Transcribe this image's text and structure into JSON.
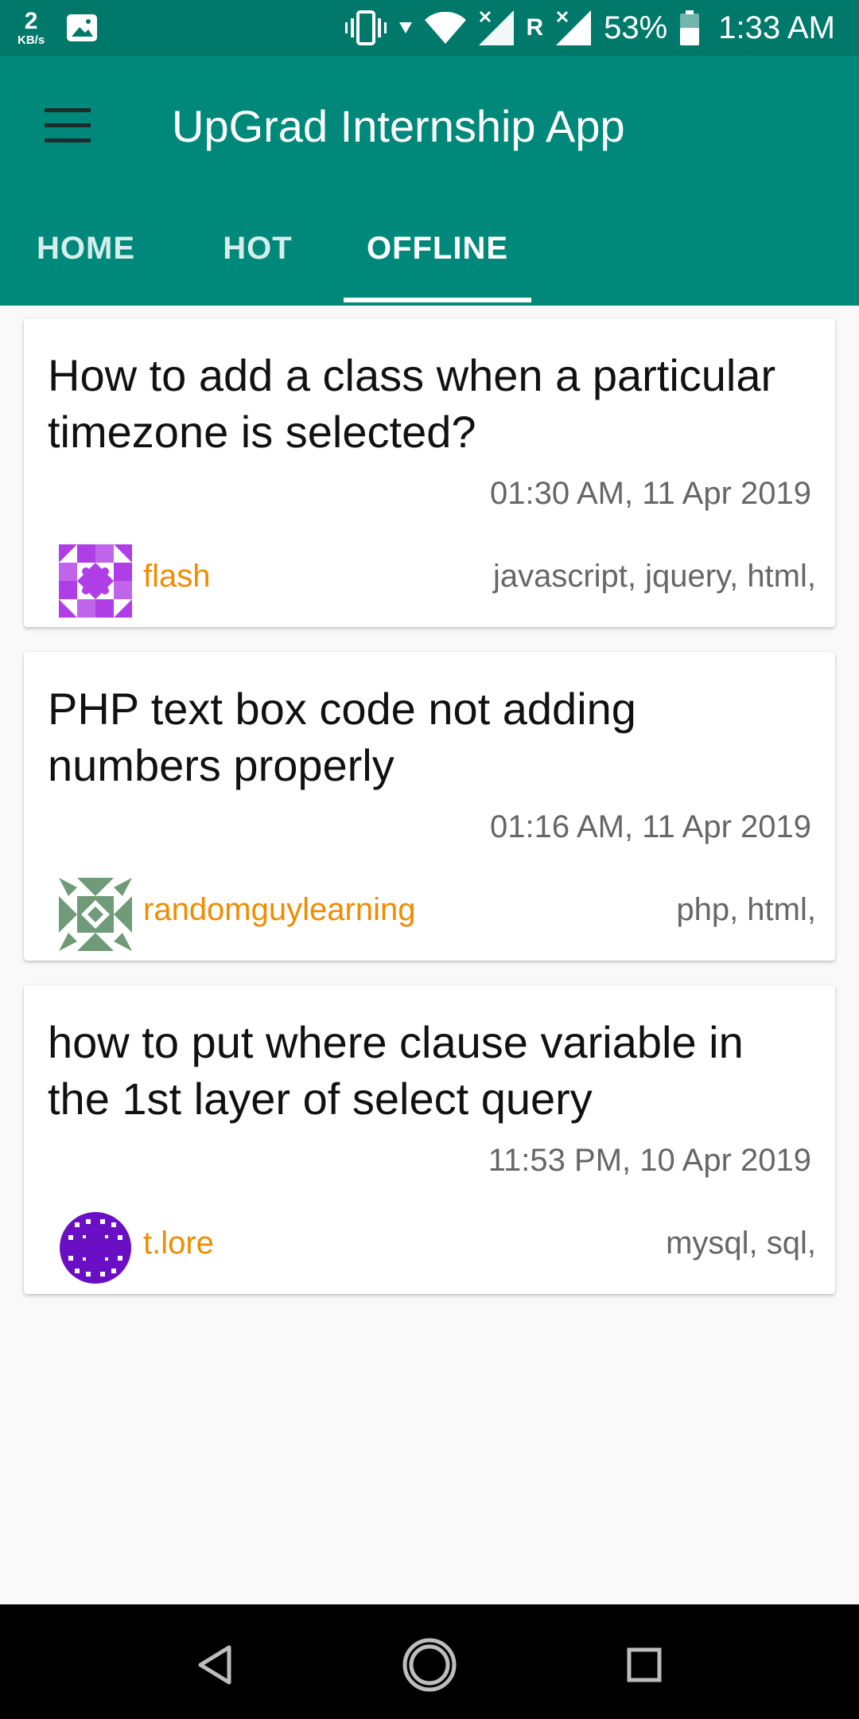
{
  "status_bar": {
    "net_speed_value": "2",
    "net_speed_unit": "KB/s",
    "roaming": "R",
    "battery_percent": "53%",
    "time": "1:33 AM"
  },
  "app_bar": {
    "title": "UpGrad Internship App",
    "tabs": [
      {
        "label": "HOME",
        "active": false
      },
      {
        "label": "HOT",
        "active": false
      },
      {
        "label": "OFFLINE",
        "active": true
      }
    ]
  },
  "colors": {
    "primary": "#00897b",
    "primary_dark": "#00796b",
    "username": "#f08c00"
  },
  "questions": [
    {
      "title": "How to add a class when a particular timezone is selected?",
      "time": "01:30 AM, 11 Apr 2019",
      "user": "flash",
      "tags": "javascript, jquery, html,",
      "avatar_color": "#b03ee6"
    },
    {
      "title": "PHP text box code not adding numbers properly",
      "time": "01:16 AM, 11 Apr 2019",
      "user": "randomguylearning",
      "tags": "php, html,",
      "avatar_color": "#6f9b78"
    },
    {
      "title": "how to put where clause variable in the 1st layer of select query",
      "time": "11:53 PM, 10 Apr 2019",
      "user": "t.lore",
      "tags": "mysql, sql,",
      "avatar_color": "#6a0fc4"
    }
  ],
  "nav_bar": {
    "icons": [
      "back-icon",
      "home-icon",
      "recents-icon"
    ]
  }
}
